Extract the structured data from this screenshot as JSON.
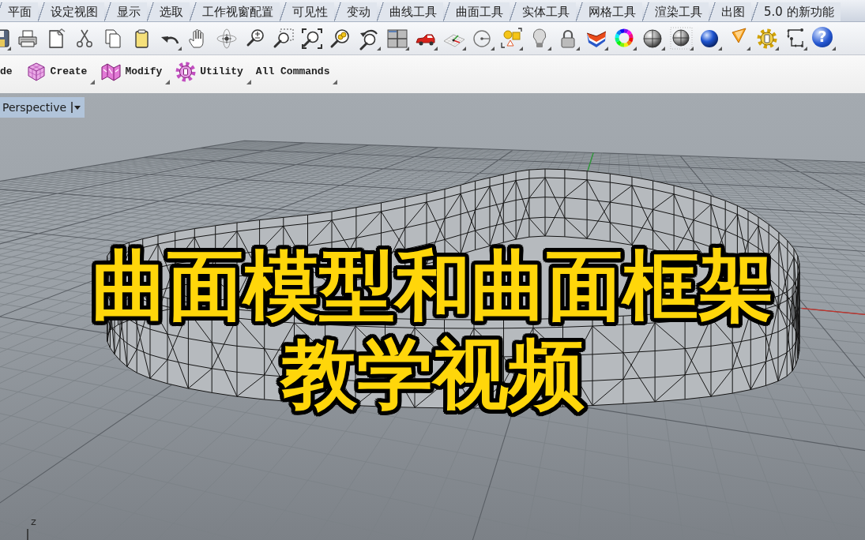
{
  "ribbon_tabs": [
    {
      "label": "平面",
      "selected": false
    },
    {
      "label": "设定视图",
      "selected": false
    },
    {
      "label": "显示",
      "selected": false
    },
    {
      "label": "选取",
      "selected": false
    },
    {
      "label": "工作视窗配置",
      "selected": false
    },
    {
      "label": "可见性",
      "selected": false
    },
    {
      "label": "变动",
      "selected": false
    },
    {
      "label": "曲线工具",
      "selected": false
    },
    {
      "label": "曲面工具",
      "selected": false
    },
    {
      "label": "实体工具",
      "selected": false
    },
    {
      "label": "网格工具",
      "selected": false
    },
    {
      "label": "渲染工具",
      "selected": false
    },
    {
      "label": "出图",
      "selected": false
    },
    {
      "label": "5.0 的新功能",
      "selected": false
    }
  ],
  "toolbar": {
    "help_label": "?"
  },
  "command_bar": [
    {
      "label": "de"
    },
    {
      "label": "Create"
    },
    {
      "label": "Modify"
    },
    {
      "label": "Utility"
    },
    {
      "label": "All Commands"
    }
  ],
  "viewport": {
    "title": "Perspective",
    "axis_label": "z",
    "overlay_title": [
      "曲面模型和曲面框架",
      "教学视频"
    ]
  }
}
